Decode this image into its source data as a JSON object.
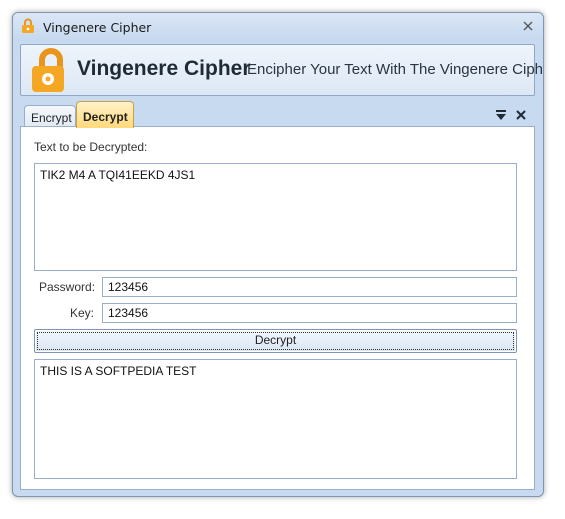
{
  "window": {
    "title": "Vingenere Cipher"
  },
  "banner": {
    "title": "Vingenere Cipher",
    "subtitle": "Encipher Your Text With The Vingenere Cipher"
  },
  "tabs": [
    {
      "label": "Encrypt",
      "active": false
    },
    {
      "label": "Decrypt",
      "active": true
    }
  ],
  "decrypt": {
    "input_label": "Text to be Decrypted:",
    "input_text": "TIK2 M4 A TQI41EEKD 4JS1",
    "password_label": "Password:",
    "password_value": "123456",
    "key_label": "Key:",
    "key_value": "123456",
    "button_label": "Decrypt",
    "output_text": "THIS IS A SOFTPEDIA TEST"
  },
  "icons": {
    "app": "lock-icon",
    "close": "close-icon",
    "panel_menu": "dropdown-menu-icon",
    "panel_close": "close-icon"
  },
  "colors": {
    "chrome": "#c8daf0",
    "active_tab": "#ffd97a",
    "lock_orange": "#f5a623"
  }
}
